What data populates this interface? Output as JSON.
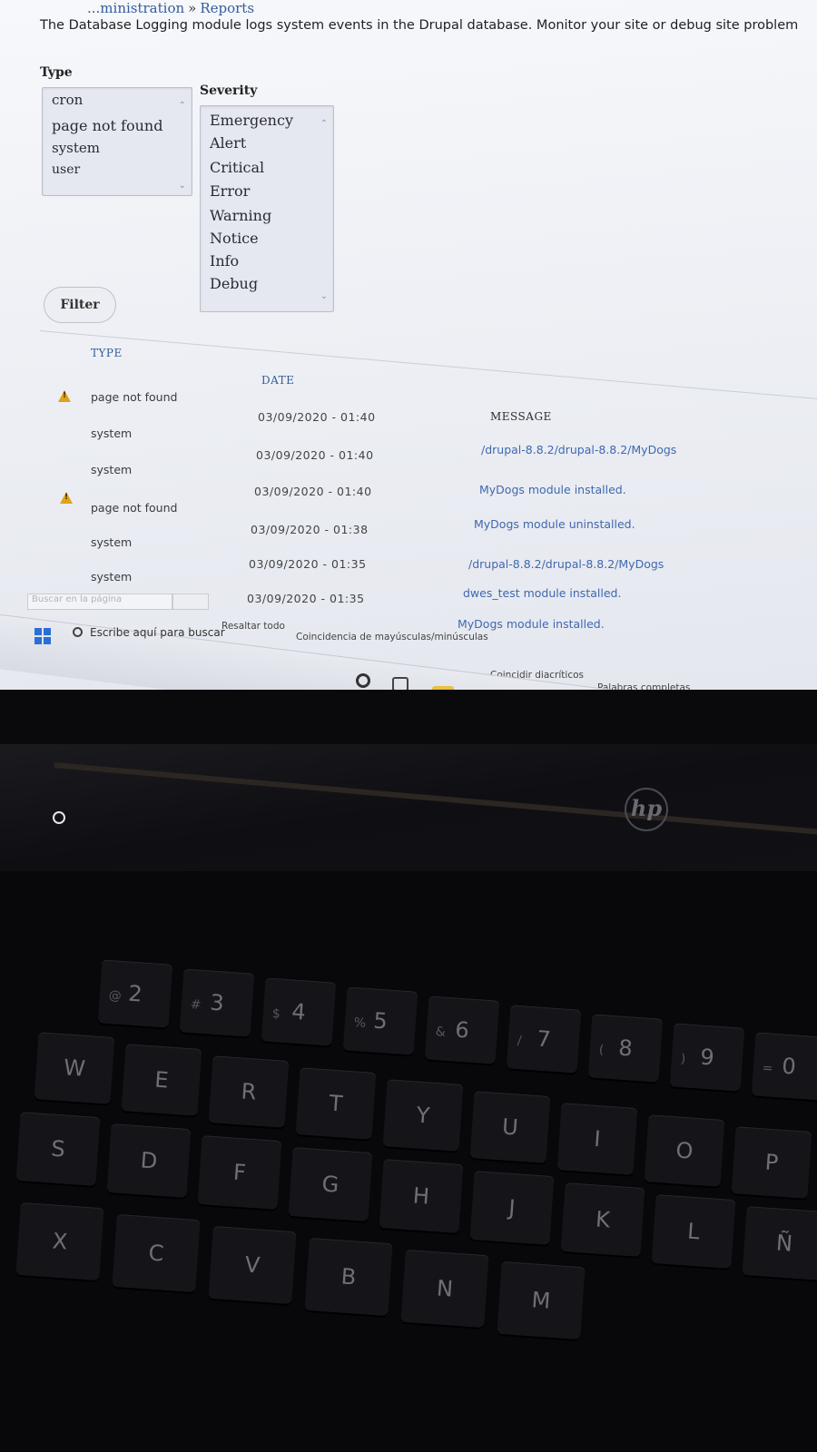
{
  "breadcrumb": {
    "parent": "...ministration",
    "separator": "»",
    "current": "Reports"
  },
  "description": "The Database Logging module logs system events in the Drupal database. Monitor your site or debug site problem",
  "filters": {
    "type_label": "Type",
    "type_options": [
      "cron",
      "page not found",
      "system",
      "user"
    ],
    "severity_label": "Severity",
    "severity_options": [
      "Emergency",
      "Alert",
      "Critical",
      "Error",
      "Warning",
      "Notice",
      "Info",
      "Debug"
    ],
    "filter_button": "Filter"
  },
  "table": {
    "headers": {
      "type": "TYPE",
      "date": "DATE",
      "message": "MESSAGE"
    },
    "rows": [
      {
        "warning": true,
        "type": "page not found",
        "date": "03/09/2020 - 01:40",
        "message": "/drupal-8.8.2/drupal-8.8.2/MyDogs"
      },
      {
        "warning": false,
        "type": "system",
        "date": "03/09/2020 - 01:40",
        "message": "MyDogs module installed."
      },
      {
        "warning": false,
        "type": "system",
        "date": "03/09/2020 - 01:40",
        "message": "MyDogs module uninstalled."
      },
      {
        "warning": true,
        "type": "page not found",
        "date": "03/09/2020 - 01:38",
        "message": "/drupal-8.8.2/drupal-8.8.2/MyDogs"
      },
      {
        "warning": false,
        "type": "system",
        "date": "03/09/2020 - 01:35",
        "message": "dwes_test module installed."
      },
      {
        "warning": false,
        "type": "system",
        "date": "03/09/2020 - 01:35",
        "message": "MyDogs module installed."
      }
    ]
  },
  "findbar": {
    "placeholder": "Buscar en la página",
    "highlight_all": "Resaltar todo",
    "match_case": "Coincidencia de mayúsculas/minúsculas",
    "match_diacritics": "Coincidir diacríticos",
    "whole_words": "Palabras completas"
  },
  "taskbar": {
    "search_placeholder": "Escribe aquí para buscar",
    "icons": [
      "cortana-icon",
      "task-view-icon",
      "file-explorer-icon",
      "terminal-icon",
      "firefox-icon",
      "spotify-icon",
      "filezilla-icon",
      "word-icon",
      "remote-desktop-icon"
    ],
    "colors": {
      "start": "#2a6fd6",
      "firefox": "#f07020",
      "spotify": "#1db954",
      "filezilla": "#d0302a",
      "word": "#2b579a"
    }
  },
  "laptop": {
    "brand": "hp",
    "keys": {
      "row_numbers": [
        {
          "main": "2",
          "alt": "@"
        },
        {
          "main": "3",
          "alt": "#"
        },
        {
          "main": "4",
          "alt": "$"
        },
        {
          "main": "5",
          "alt": "%"
        },
        {
          "main": "6",
          "alt": "&"
        },
        {
          "main": "7",
          "alt": "/"
        },
        {
          "main": "8",
          "alt": "("
        },
        {
          "main": "9",
          "alt": ")"
        },
        {
          "main": "0",
          "alt": "="
        }
      ],
      "row_qwerty": [
        "W",
        "E",
        "R",
        "T",
        "Y",
        "U",
        "I",
        "O",
        "P"
      ],
      "row_home": [
        "S",
        "D",
        "F",
        "G",
        "H",
        "J",
        "K",
        "L",
        "Ñ"
      ],
      "row_bottom": [
        "X",
        "C",
        "V",
        "B",
        "N",
        "M"
      ]
    }
  }
}
